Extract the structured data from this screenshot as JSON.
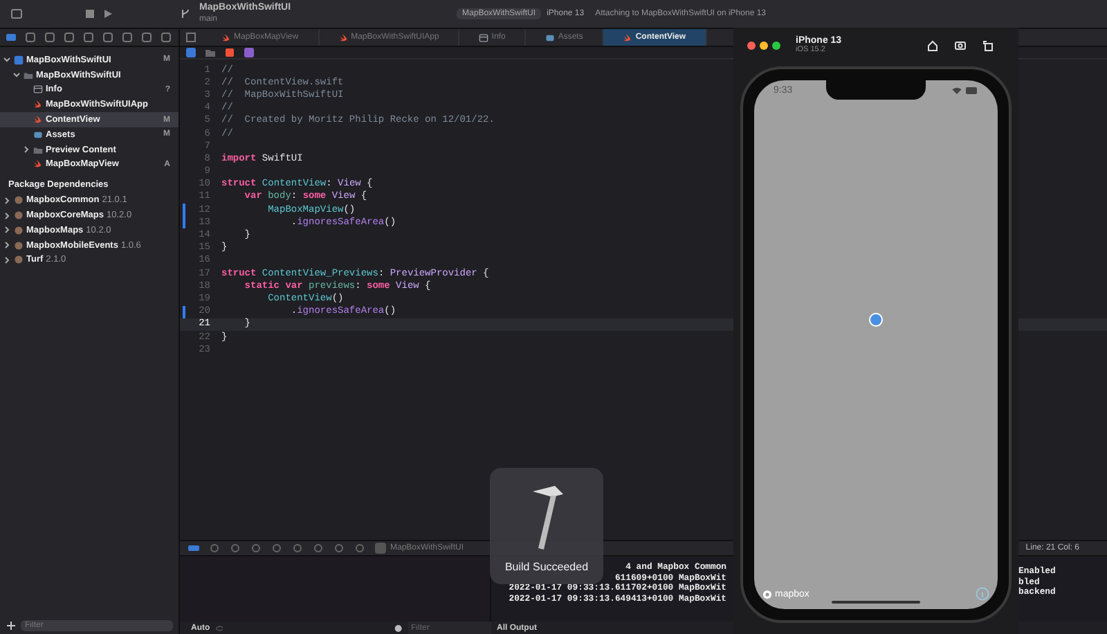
{
  "toolbar": {
    "project": "MapBoxWithSwiftUI",
    "branch": "main",
    "scheme": "MapBoxWithSwiftUI",
    "destination": "iPhone 13",
    "status": "Attaching to MapBoxWithSwiftUI on iPhone 13"
  },
  "tabs": [
    {
      "label": "MapBoxMapView",
      "kind": "swift",
      "selected": false
    },
    {
      "label": "MapBoxWithSwiftUIApp",
      "kind": "swift",
      "selected": false
    },
    {
      "label": "Info",
      "kind": "plist",
      "selected": false
    },
    {
      "label": "Assets",
      "kind": "assets",
      "selected": false
    },
    {
      "label": "ContentView",
      "kind": "swift",
      "selected": true
    }
  ],
  "navigator": {
    "tree": [
      {
        "label": "MapBoxWithSwiftUI",
        "kind": "project",
        "badge": "M",
        "expanded": true,
        "selected": false,
        "children": [
          {
            "label": "MapBoxWithSwiftUI",
            "kind": "folder",
            "expanded": true,
            "selected": false,
            "children": [
              {
                "label": "Info",
                "kind": "plist",
                "badge": "?",
                "selected": false
              },
              {
                "label": "MapBoxWithSwiftUIApp",
                "kind": "swift",
                "selected": false
              },
              {
                "label": "ContentView",
                "kind": "swift",
                "badge": "M",
                "selected": true
              },
              {
                "label": "Assets",
                "kind": "assets",
                "badge": "M",
                "selected": false
              },
              {
                "label": "Preview Content",
                "kind": "folder",
                "expanded": false,
                "selected": false
              },
              {
                "label": "MapBoxMapView",
                "kind": "swift",
                "badge": "A",
                "selected": false
              }
            ]
          }
        ]
      }
    ],
    "packages_header": "Package Dependencies",
    "packages": [
      {
        "name": "MapboxCommon",
        "version": "21.0.1",
        "expanded": false
      },
      {
        "name": "MapboxCoreMaps",
        "version": "10.2.0",
        "expanded": false
      },
      {
        "name": "MapboxMaps",
        "version": "10.2.0",
        "expanded": false
      },
      {
        "name": "MapboxMobileEvents",
        "version": "1.0.6",
        "expanded": false
      },
      {
        "name": "Turf",
        "version": "2.1.0",
        "expanded": false
      }
    ],
    "filter_placeholder": "Filter"
  },
  "editor": {
    "lines": [
      {
        "number": "1",
        "changed": false,
        "current": false,
        "tokens": [
          {
            "kind": "comment",
            "text": "//"
          }
        ]
      },
      {
        "number": "2",
        "changed": false,
        "current": false,
        "tokens": [
          {
            "kind": "comment",
            "text": "//  ContentView.swift"
          }
        ]
      },
      {
        "number": "3",
        "changed": false,
        "current": false,
        "tokens": [
          {
            "kind": "comment",
            "text": "//  MapBoxWithSwiftUI"
          }
        ]
      },
      {
        "number": "4",
        "changed": false,
        "current": false,
        "tokens": [
          {
            "kind": "comment",
            "text": "//"
          }
        ]
      },
      {
        "number": "5",
        "changed": false,
        "current": false,
        "tokens": [
          {
            "kind": "comment",
            "text": "//  Created by Moritz Philip Recke on 12/01/22."
          }
        ]
      },
      {
        "number": "6",
        "changed": false,
        "current": false,
        "tokens": [
          {
            "kind": "comment",
            "text": "//"
          }
        ]
      },
      {
        "number": "7",
        "changed": false,
        "current": false
      },
      {
        "number": "8",
        "changed": false,
        "current": false,
        "tokens": [
          {
            "kind": "keyword",
            "text": "import"
          },
          {
            "kind": "plain",
            "text": " SwiftUI"
          }
        ]
      },
      {
        "number": "9",
        "changed": false,
        "current": false
      },
      {
        "number": "10",
        "changed": false,
        "current": false,
        "tokens": [
          {
            "kind": "keyword",
            "text": "struct"
          },
          {
            "kind": "type",
            "text": " ContentView"
          },
          {
            "kind": "plain",
            "text": ": "
          },
          {
            "kind": "systype",
            "text": "View"
          },
          {
            "kind": "plain",
            "text": " {"
          }
        ]
      },
      {
        "number": "11",
        "changed": false,
        "current": false,
        "tokens": [
          {
            "kind": "keyword",
            "text": "    var"
          },
          {
            "kind": "decl",
            "text": " body"
          },
          {
            "kind": "plain",
            "text": ": "
          },
          {
            "kind": "keyword",
            "text": "some"
          },
          {
            "kind": "systype",
            "text": " View"
          },
          {
            "kind": "plain",
            "text": " {"
          }
        ]
      },
      {
        "number": "12",
        "changed": true,
        "current": false,
        "tokens": [
          {
            "kind": "type",
            "text": "        MapBoxMapView"
          },
          {
            "kind": "plain",
            "text": "()"
          }
        ]
      },
      {
        "number": "13",
        "changed": true,
        "current": false,
        "tokens": [
          {
            "kind": "plain",
            "text": "            ."
          },
          {
            "kind": "method",
            "text": "ignoresSafeArea"
          },
          {
            "kind": "plain",
            "text": "()"
          }
        ]
      },
      {
        "number": "14",
        "changed": false,
        "current": false,
        "tokens": [
          {
            "kind": "plain",
            "text": "    }"
          }
        ]
      },
      {
        "number": "15",
        "changed": false,
        "current": false,
        "tokens": [
          {
            "kind": "plain",
            "text": "}"
          }
        ]
      },
      {
        "number": "16",
        "changed": false,
        "current": false
      },
      {
        "number": "17",
        "changed": false,
        "current": false,
        "tokens": [
          {
            "kind": "keyword",
            "text": "struct"
          },
          {
            "kind": "type",
            "text": " ContentView_Previews"
          },
          {
            "kind": "plain",
            "text": ": "
          },
          {
            "kind": "systype",
            "text": "PreviewProvider"
          },
          {
            "kind": "plain",
            "text": " {"
          }
        ]
      },
      {
        "number": "18",
        "changed": false,
        "current": false,
        "tokens": [
          {
            "kind": "keyword",
            "text": "    static var"
          },
          {
            "kind": "decl",
            "text": " previews"
          },
          {
            "kind": "plain",
            "text": ": "
          },
          {
            "kind": "keyword",
            "text": "some"
          },
          {
            "kind": "systype",
            "text": " View"
          },
          {
            "kind": "plain",
            "text": " {"
          }
        ]
      },
      {
        "number": "19",
        "changed": false,
        "current": false,
        "tokens": [
          {
            "kind": "type",
            "text": "        ContentView"
          },
          {
            "kind": "plain",
            "text": "()"
          }
        ]
      },
      {
        "number": "20",
        "changed": true,
        "current": false,
        "tokens": [
          {
            "kind": "plain",
            "text": "            ."
          },
          {
            "kind": "method",
            "text": "ignoresSafeArea"
          },
          {
            "kind": "plain",
            "text": "()"
          }
        ]
      },
      {
        "number": "21",
        "changed": false,
        "current": true,
        "tokens": [
          {
            "kind": "plain",
            "text": "    }"
          }
        ]
      },
      {
        "number": "22",
        "changed": false,
        "current": false,
        "tokens": [
          {
            "kind": "plain",
            "text": "}"
          }
        ]
      },
      {
        "number": "23",
        "changed": false,
        "current": false
      }
    ]
  },
  "debug": {
    "target": "MapBoxWithSwiftUI",
    "cursor": "Line: 21  Col: 6",
    "variables_scope": "Auto",
    "filter_placeholder": "Filter",
    "output_scope": "All Output",
    "console_lines": [
      "4 and Mapbox Common",
      "611609+0100 MapBoxWit",
      "2022-01-17 09:33:13.611702+0100 MapBoxWit",
      "2022-01-17 09:33:13.649413+0100 MapBoxWit"
    ],
    "console_tail": [
      "Enabled",
      "bled",
      "backend"
    ]
  },
  "hud": {
    "message": "Build Succeeded"
  },
  "simulator": {
    "device": "iPhone 13",
    "os": "iOS 15.2",
    "time": "9:33",
    "map_logo": "mapbox"
  }
}
